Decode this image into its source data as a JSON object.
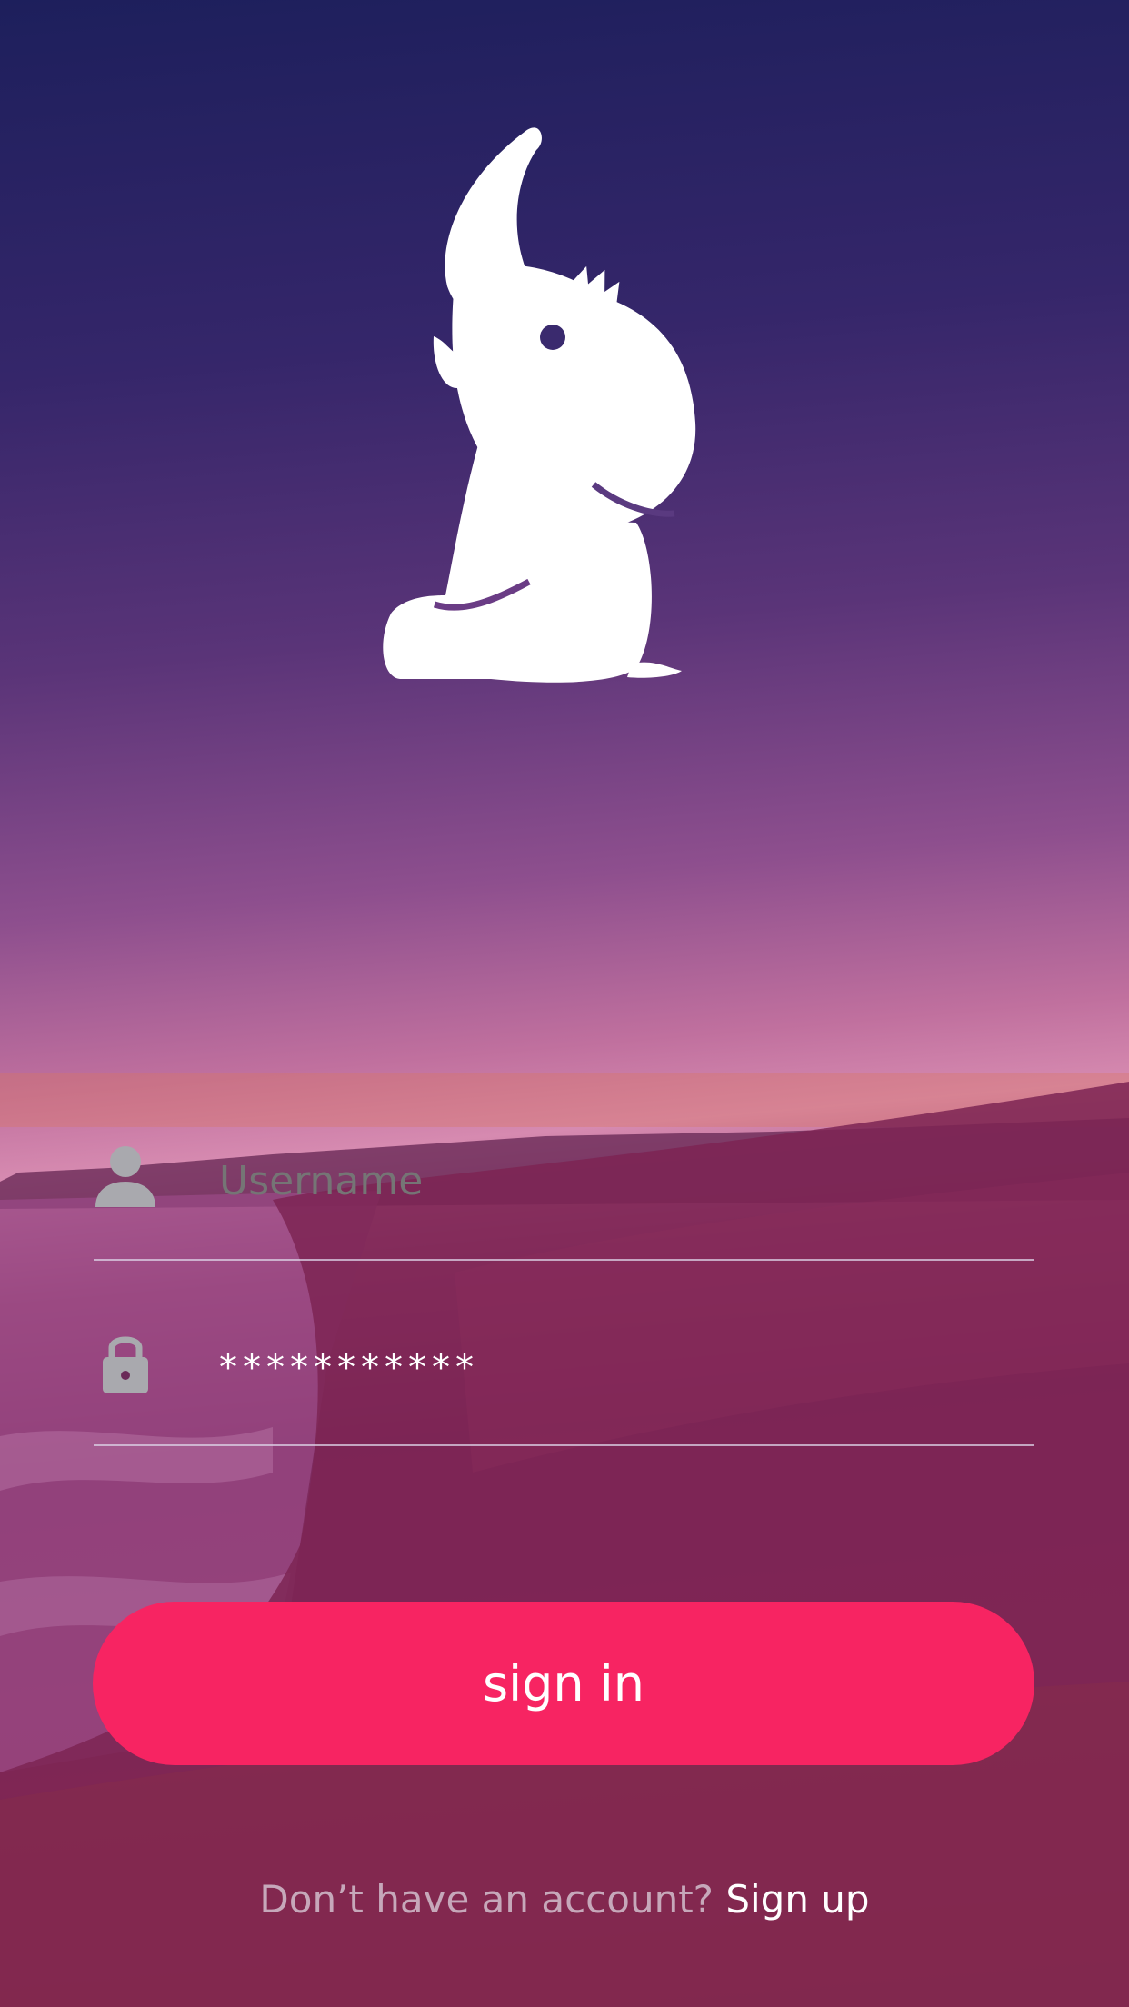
{
  "form": {
    "username": {
      "placeholder": "Username",
      "value": "",
      "icon": "user-icon"
    },
    "password": {
      "value": "***********",
      "icon": "lock-icon"
    }
  },
  "actions": {
    "signin_label": "sign in",
    "signup_prompt": "Don’t have an account?",
    "signup_link": "Sign up"
  },
  "colors": {
    "button": "#f72462",
    "icon": "#a9a9ae"
  },
  "logo": {
    "icon": "elephant-crown-logo"
  }
}
